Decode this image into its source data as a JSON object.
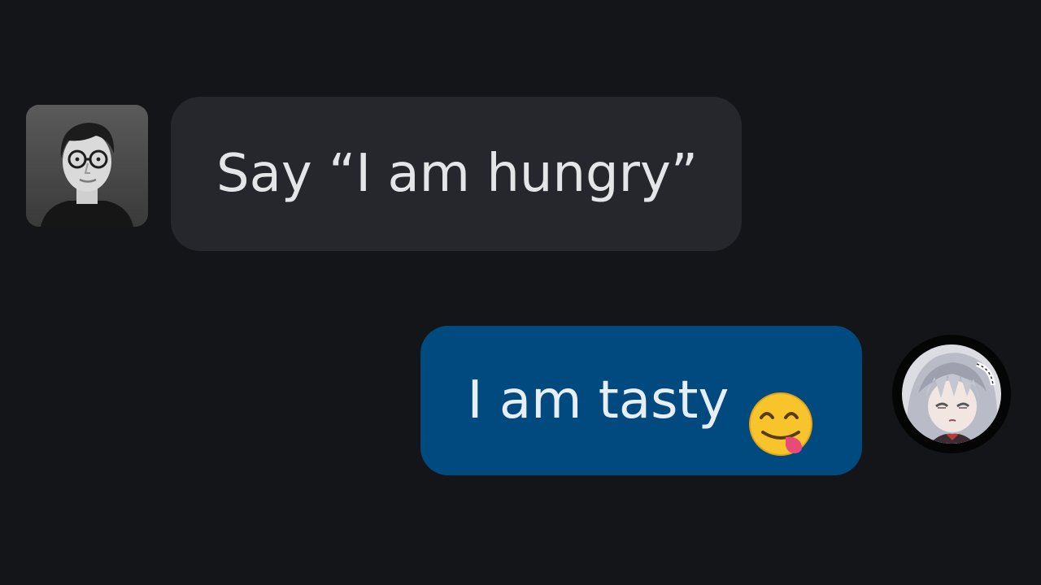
{
  "conversation": {
    "messages": [
      {
        "role": "user",
        "text": "Say “I am hungry”",
        "avatar_icon": "man-with-glasses-avatar"
      },
      {
        "role": "assistant",
        "text": "I am tasty",
        "emoji_icon": "face-savoring-food-emoji",
        "avatar_icon": "anime-character-avatar"
      }
    ]
  },
  "colors": {
    "background": "#141518",
    "user_bubble": "#25272c",
    "assistant_bubble": "#004a80",
    "text": "#e4e5e7"
  }
}
